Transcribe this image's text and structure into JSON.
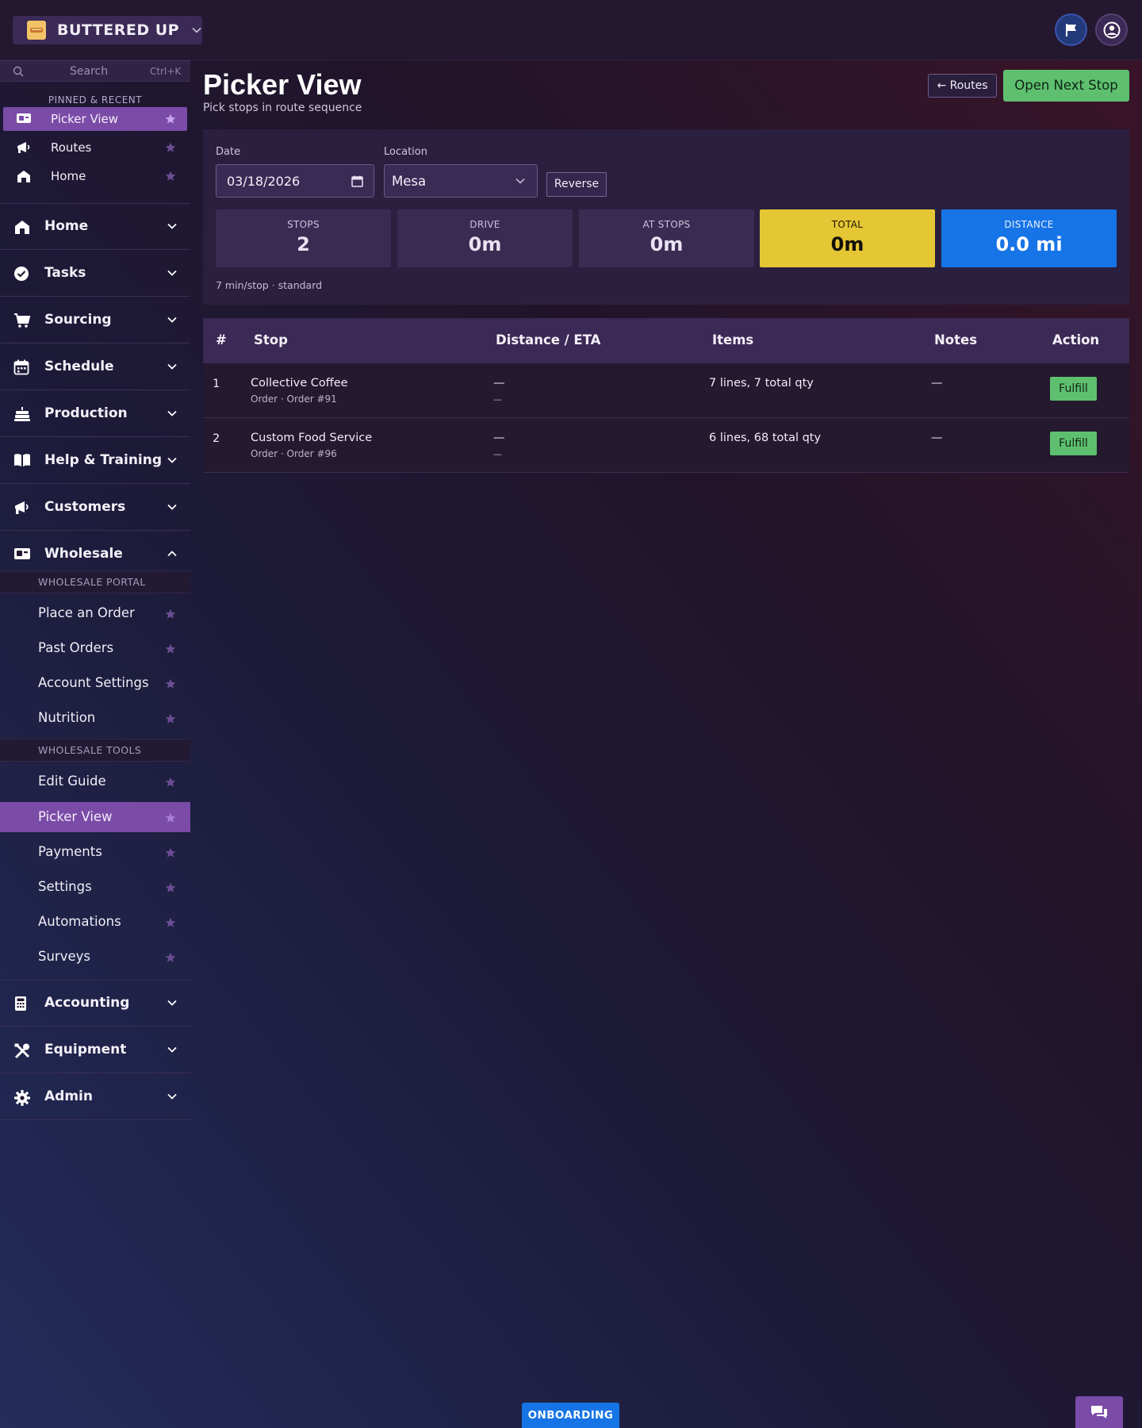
{
  "brand": {
    "name": "BUTTERED UP"
  },
  "search": {
    "placeholder": "Search",
    "shortcut": "Ctrl+K"
  },
  "sidebar": {
    "pinned_caption": "PINNED & RECENT",
    "pinned": [
      {
        "label": "Picker View",
        "icon": "register-icon",
        "active": true
      },
      {
        "label": "Routes",
        "icon": "megaphone-icon",
        "active": false
      },
      {
        "label": "Home",
        "icon": "home-icon",
        "active": false
      }
    ],
    "groups": [
      {
        "label": "Home",
        "icon": "home-icon"
      },
      {
        "label": "Tasks",
        "icon": "check-circle-icon"
      },
      {
        "label": "Sourcing",
        "icon": "cart-icon"
      },
      {
        "label": "Schedule",
        "icon": "calendar-icon"
      },
      {
        "label": "Production",
        "icon": "cake-icon"
      },
      {
        "label": "Help & Training",
        "icon": "book-icon"
      },
      {
        "label": "Customers",
        "icon": "megaphone-icon"
      },
      {
        "label": "Wholesale",
        "icon": "register-icon",
        "expanded": true
      },
      {
        "label": "Accounting",
        "icon": "calculator-icon"
      },
      {
        "label": "Equipment",
        "icon": "tools-icon"
      },
      {
        "label": "Admin",
        "icon": "gear-icon"
      }
    ],
    "wholesale": {
      "portal_caption": "WHOLESALE PORTAL",
      "portal_items": [
        "Place an Order",
        "Past Orders",
        "Account Settings",
        "Nutrition"
      ],
      "tools_caption": "WHOLESALE TOOLS",
      "tools_items": [
        "Edit Guide",
        "Picker View",
        "Payments",
        "Settings",
        "Automations",
        "Surveys"
      ],
      "active_item": "Picker View"
    }
  },
  "page": {
    "title": "Picker View",
    "subtitle": "Pick stops in route sequence",
    "routes_button": "← Routes",
    "next_button": "Open Next Stop"
  },
  "filters": {
    "date_label": "Date",
    "date_value": "03/18/2026",
    "location_label": "Location",
    "location_value": "Mesa",
    "reverse_button": "Reverse"
  },
  "stats": [
    {
      "caption": "STOPS",
      "value": "2"
    },
    {
      "caption": "DRIVE",
      "value": "0m"
    },
    {
      "caption": "AT STOPS",
      "value": "0m"
    },
    {
      "caption": "TOTAL",
      "value": "0m"
    },
    {
      "caption": "DISTANCE",
      "value": "0.0 mi"
    }
  ],
  "stats_note": "7 min/stop · standard",
  "table": {
    "columns": [
      "#",
      "Stop",
      "Distance / ETA",
      "Items",
      "Notes",
      "Action"
    ],
    "rows": [
      {
        "num": "1",
        "stop": "Collective Coffee",
        "stop_sub": "Order · Order #91",
        "distance": "—",
        "eta": "—",
        "items": "7 lines, 7 total qty",
        "notes": "—",
        "action": "Fulfill"
      },
      {
        "num": "2",
        "stop": "Custom Food Service",
        "stop_sub": "Order · Order #96",
        "distance": "—",
        "eta": "—",
        "items": "6 lines, 68 total qty",
        "notes": "—",
        "action": "Fulfill"
      }
    ]
  },
  "footer": {
    "onboarding": "ONBOARDING"
  },
  "colors": {
    "accent": "#7b4ba8",
    "success": "#5ec06f",
    "warning": "#e5c634",
    "info": "#1674e6"
  }
}
